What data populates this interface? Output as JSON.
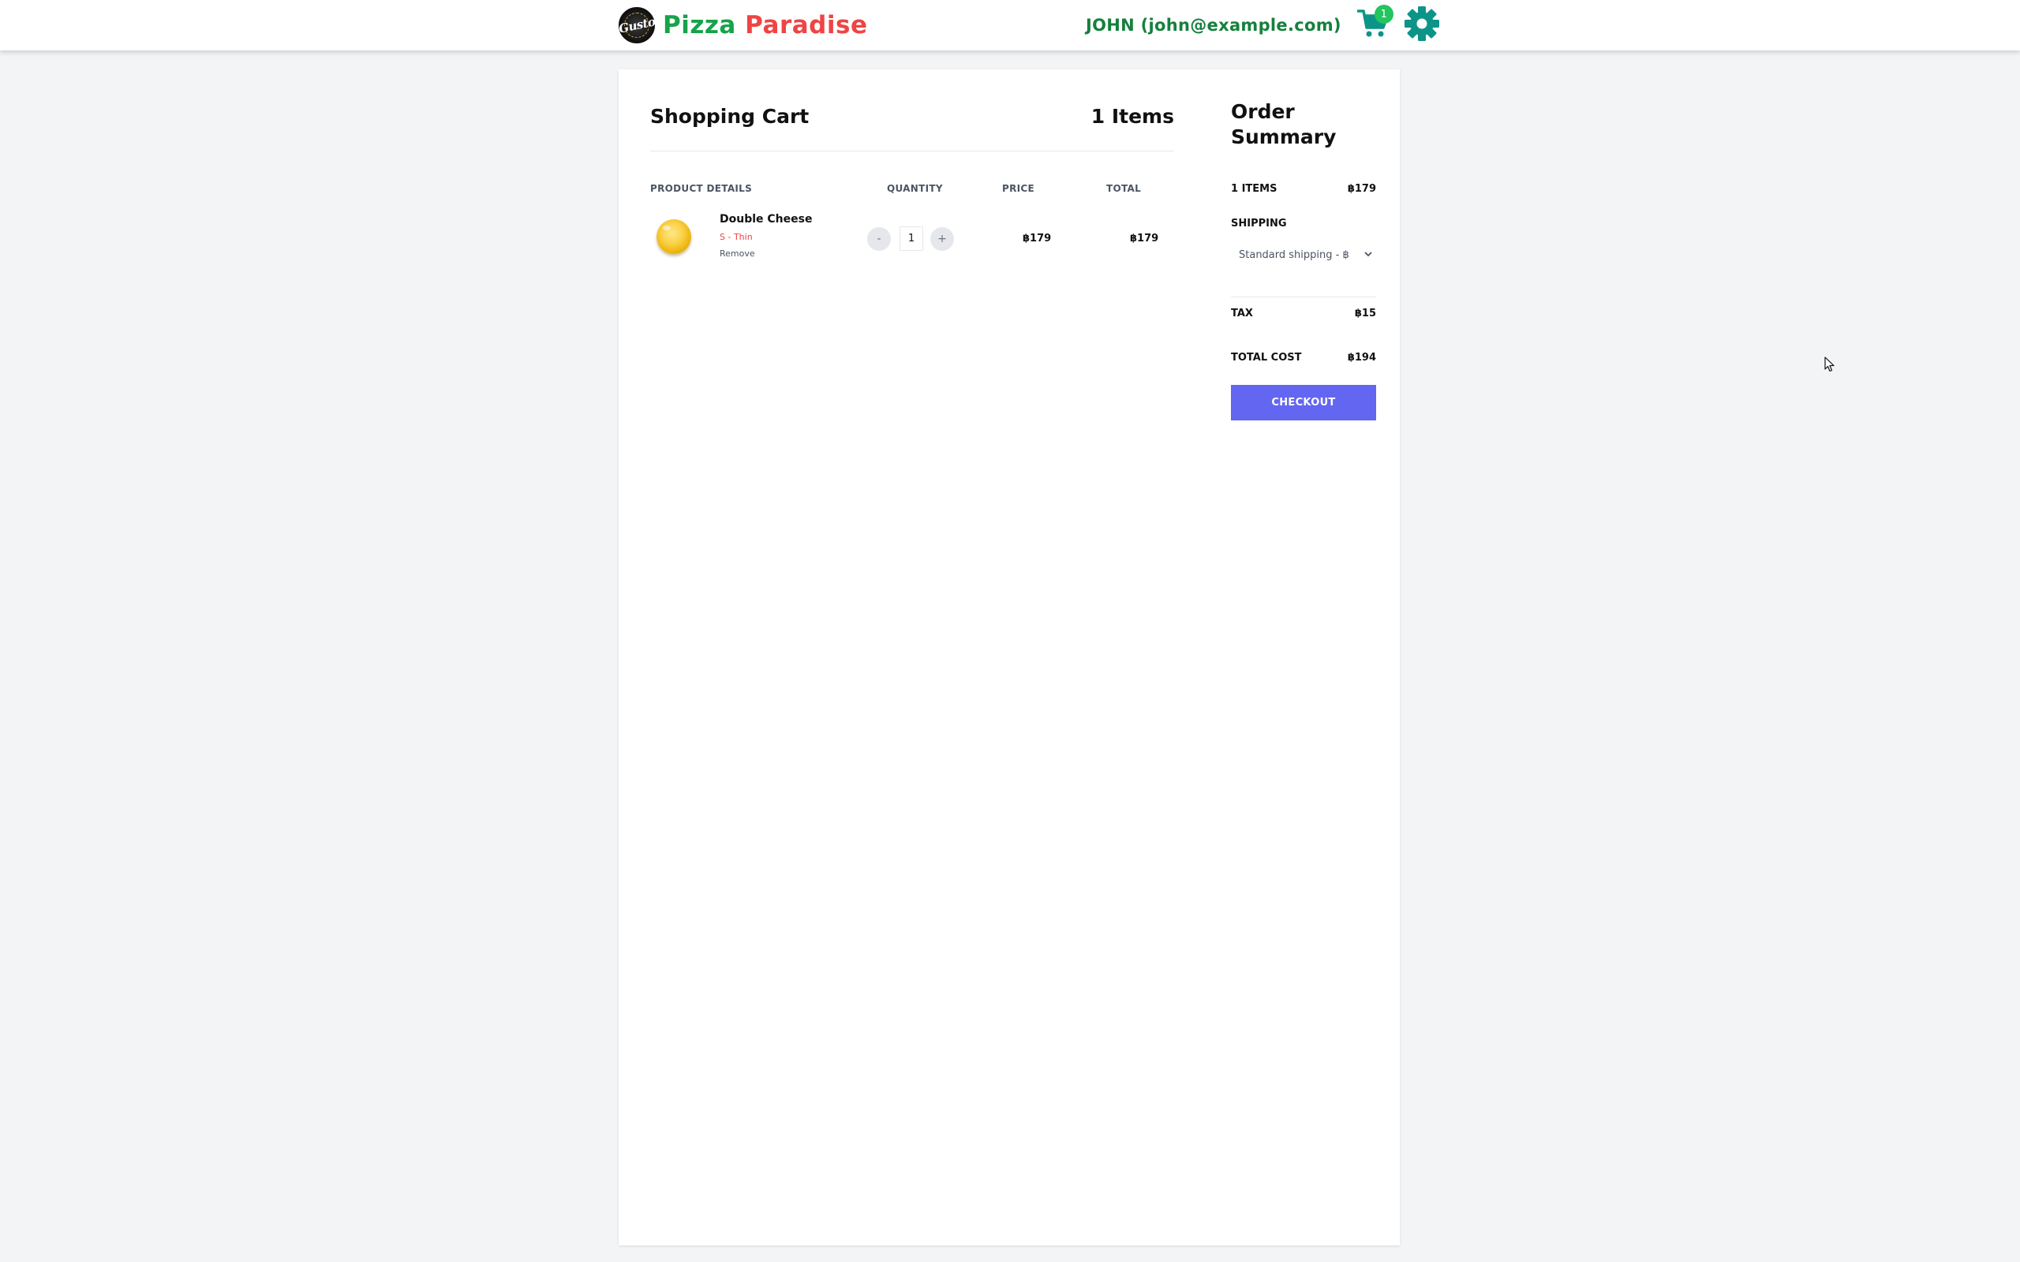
{
  "brand": {
    "logo_text": "Gusto",
    "title_part1": "Pizza",
    "title_part2": "Paradise"
  },
  "header": {
    "user_label": "JOHN (john@example.com)",
    "cart_badge": "1",
    "cart_icon": "cart-icon",
    "settings_icon": "gear-icon"
  },
  "cart": {
    "title": "Shopping Cart",
    "count_label": "1 Items",
    "columns": [
      "PRODUCT DETAILS",
      "QUANTITY",
      "PRICE",
      "TOTAL"
    ],
    "items": [
      {
        "name": "Double Cheese",
        "variant": "S - Thin",
        "remove_label": "Remove",
        "minus_label": "-",
        "plus_label": "+",
        "quantity": "1",
        "price": "฿179",
        "total": "฿179"
      }
    ]
  },
  "summary": {
    "title": "Order Summary",
    "items_label": "1 ITEMS",
    "items_value": "฿179",
    "shipping_label": "SHIPPING",
    "shipping_selected": "Standard shipping - ฿",
    "tax_label": "TAX",
    "tax_value": "฿15",
    "total_label": "TOTAL COST",
    "total_value": "฿194",
    "checkout_label": "CHECKOUT"
  },
  "colors": {
    "brand_green": "#16a34a",
    "brand_red": "#ef4444",
    "icon_teal": "#0d9488",
    "badge_green": "#22c55e",
    "checkout_indigo": "#6366f1",
    "page_bg": "#f3f4f6"
  }
}
